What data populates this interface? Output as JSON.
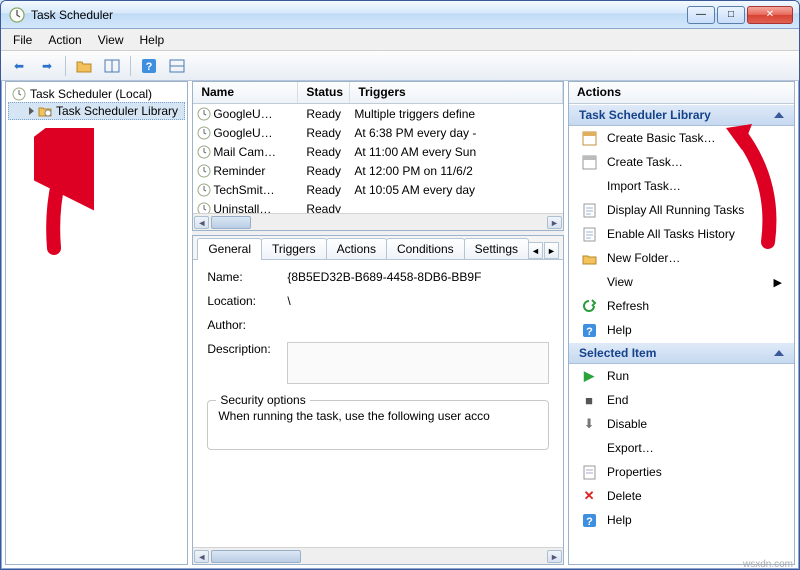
{
  "window_title": "Task Scheduler",
  "menus": [
    "File",
    "Action",
    "View",
    "Help"
  ],
  "tree": {
    "root": "Task Scheduler (Local)",
    "child": "Task Scheduler Library"
  },
  "columns": {
    "name": "Name",
    "status": "Status",
    "triggers": "Triggers"
  },
  "tasks": [
    {
      "name": "GoogleU…",
      "status": "Ready",
      "trigger": "Multiple triggers define"
    },
    {
      "name": "GoogleU…",
      "status": "Ready",
      "trigger": "At 6:38 PM every day -"
    },
    {
      "name": "Mail Cam…",
      "status": "Ready",
      "trigger": "At 11:00 AM every Sun"
    },
    {
      "name": "Reminder",
      "status": "Ready",
      "trigger": "At 12:00 PM on 11/6/2"
    },
    {
      "name": "TechSmit…",
      "status": "Ready",
      "trigger": "At 10:05 AM every day"
    },
    {
      "name": "Uninstall…",
      "status": "Ready",
      "trigger": ""
    }
  ],
  "tabs": [
    "General",
    "Triggers",
    "Actions",
    "Conditions",
    "Settings"
  ],
  "details": {
    "name_label": "Name:",
    "name_value": "{8B5ED32B-B689-4458-8DB6-BB9F",
    "location_label": "Location:",
    "location_value": "\\",
    "author_label": "Author:",
    "description_label": "Description:",
    "security_title": "Security options",
    "security_text": "When running the task, use the following user acco"
  },
  "actions_title": "Actions",
  "group_library": {
    "title": "Task Scheduler Library",
    "items": [
      "Create Basic Task…",
      "Create Task…",
      "Import Task…",
      "Display All Running Tasks",
      "Enable All Tasks History",
      "New Folder…",
      "View",
      "Refresh",
      "Help"
    ]
  },
  "group_selected": {
    "title": "Selected Item",
    "items": [
      "Run",
      "End",
      "Disable",
      "Export…",
      "Properties",
      "Delete",
      "Help"
    ]
  },
  "watermark": "wsxdn.com"
}
